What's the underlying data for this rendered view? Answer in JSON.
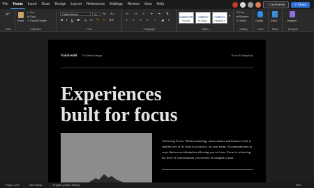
{
  "menubar": {
    "items": [
      "File",
      "Home",
      "Insert",
      "Draw",
      "Design",
      "Layout",
      "References",
      "Mailings",
      "Review",
      "View",
      "Help"
    ],
    "comments_label": "Comments",
    "share_label": "Share"
  },
  "ribbon": {
    "undo_label": "Undo",
    "paste_label": "Paste",
    "cut_label": "Cut",
    "copy_label": "Copy",
    "format_painter_label": "Format Painter",
    "font_name": "Calibri (Body)",
    "font_size": "11",
    "styles": [
      {
        "sample": "AaBbCcDc",
        "name": "Normal"
      },
      {
        "sample": "AaBbCc",
        "name": "No Spac..."
      },
      {
        "sample": "AaBbCc",
        "name": "Heading 1"
      }
    ],
    "find_label": "Find",
    "replace_label": "Replace",
    "select_label": "Select",
    "dictate_label": "Dictate",
    "editor_label": "Editor",
    "designer_label": "Designer",
    "group_labels": {
      "undo": "Undo",
      "clipboard": "Clipboard",
      "font": "Font",
      "paragraph": "Paragraph",
      "styles": "Styles",
      "editing": "Editing",
      "voice": "Voice",
      "editor": "Editor",
      "designer": "Designer"
    }
  },
  "document": {
    "brand": "VanArsdel",
    "via": "Via Shared design",
    "tagline": "Focus & Simplicity",
    "headline_line1": "Experiences",
    "headline_line2": "built for focus",
    "body": "Achieving Focus: When technology mastcronizes and behaves well, it enables you to do what you want to, on your terms. It communicates in ways that are not disruptive allowing you to focus. Focus is achieving the level of concentration you need to accomplish a task."
  },
  "statusbar": {
    "page": "Page 1 of 4",
    "words": "155 Words",
    "language": "English (United States)",
    "zoom": "50%"
  },
  "colors": {
    "accent": "#2f6fd6",
    "page_bg": "#000000",
    "canvas_bg": "#1f1f1f",
    "ribbon_bg": "#2a2a2a"
  }
}
